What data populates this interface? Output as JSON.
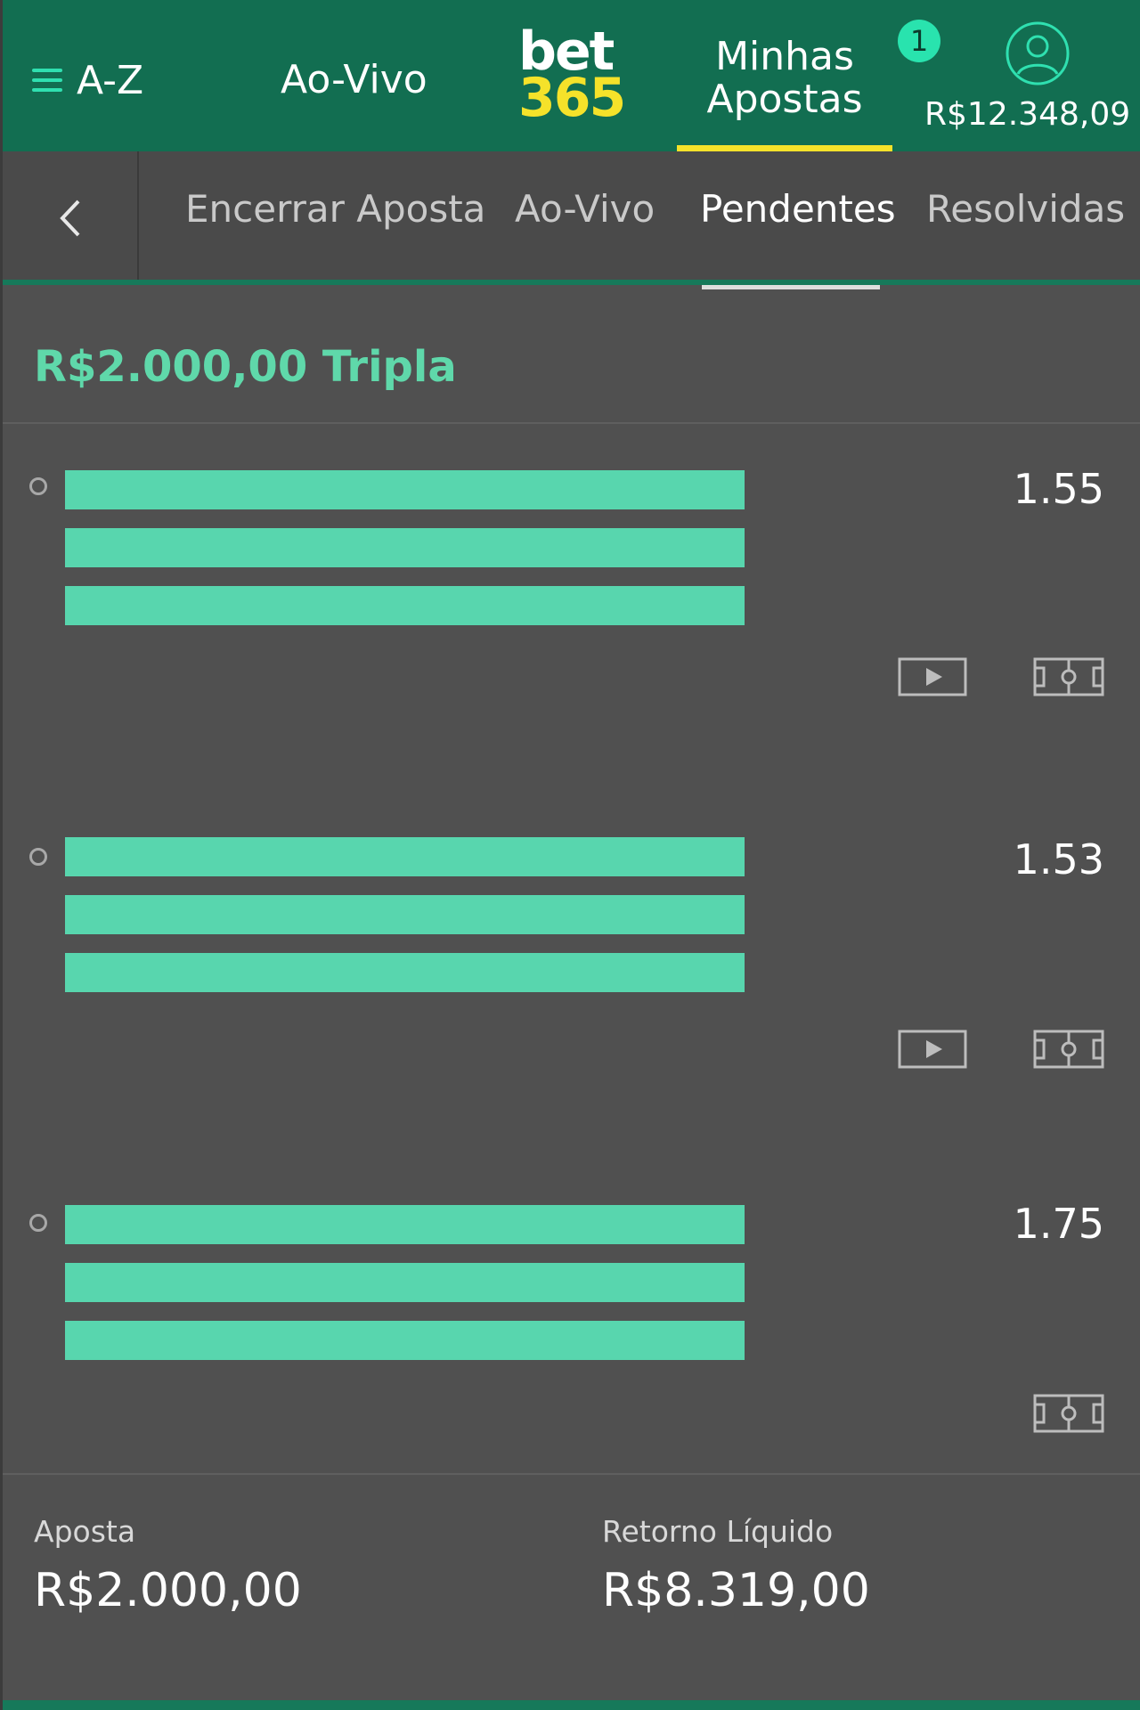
{
  "header": {
    "az_label": "A-Z",
    "aovivo_label": "Ao-Vivo",
    "logo_top": "bet",
    "logo_bottom": "365",
    "minhas_line1": "Minhas",
    "minhas_line2": "Apostas",
    "badge_count": "1",
    "balance": "R$12.348,09",
    "colors": {
      "brand_green": "#126e51",
      "accent_yellow": "#f5e22a",
      "accent_teal": "#29e3ae"
    }
  },
  "tabs": [
    {
      "label": "Encerrar Aposta",
      "active": false
    },
    {
      "label": "Ao-Vivo",
      "active": false
    },
    {
      "label": "Pendentes",
      "active": true
    },
    {
      "label": "Resolvidas",
      "active": false
    }
  ],
  "bet": {
    "title": "R$2.000,00 Tripla",
    "selections": [
      {
        "odds": "1.55",
        "icons": [
          "play-icon",
          "pitch-icon"
        ]
      },
      {
        "odds": "1.53",
        "icons": [
          "play-icon",
          "pitch-icon"
        ]
      },
      {
        "odds": "1.75",
        "icons": [
          "pitch-icon"
        ]
      }
    ]
  },
  "summary": {
    "stake_label": "Aposta",
    "stake_value": "R$2.000,00",
    "return_label": "Retorno Líquido",
    "return_value": "R$8.319,00"
  }
}
